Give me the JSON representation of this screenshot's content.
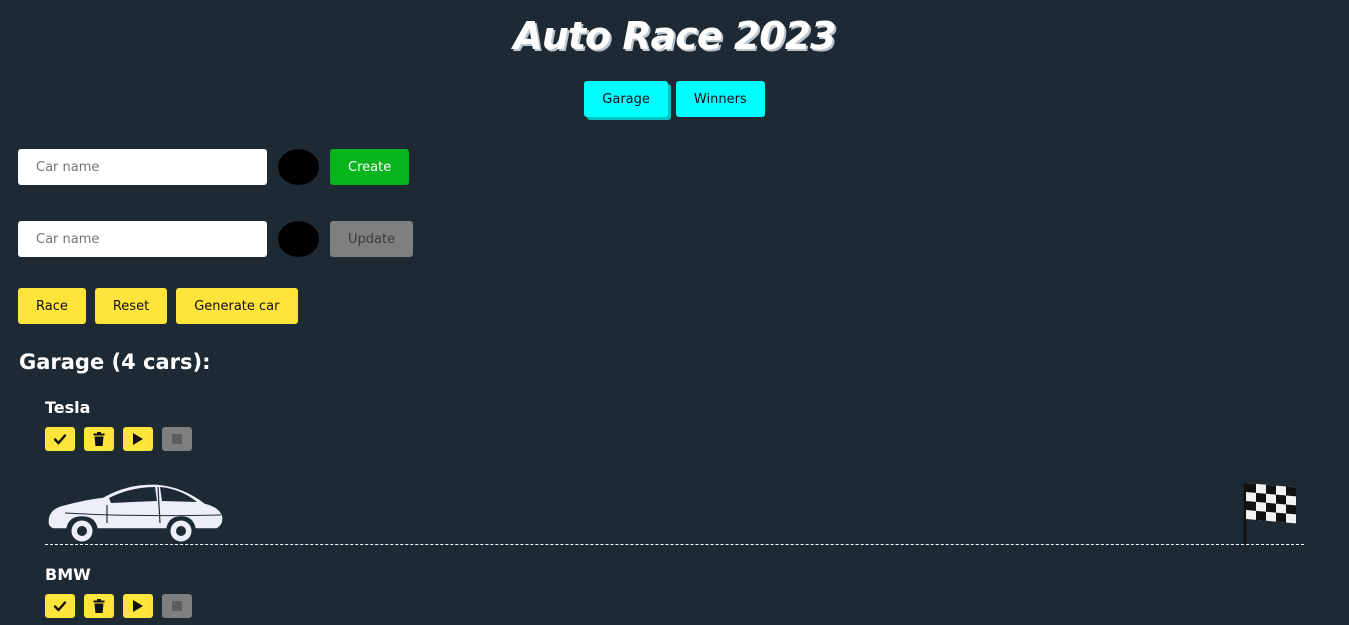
{
  "app": {
    "title": "Auto Race 2023"
  },
  "nav": {
    "garage_label": "Garage",
    "winners_label": "Winners"
  },
  "create_form": {
    "placeholder": "Car name",
    "color": "#000000",
    "button_label": "Create"
  },
  "update_form": {
    "placeholder": "Car name",
    "color": "#000000",
    "button_label": "Update"
  },
  "controls": {
    "race_label": "Race",
    "reset_label": "Reset",
    "generate_label": "Generate car"
  },
  "garage": {
    "heading": "Garage (4 cars):",
    "cars": [
      {
        "name": "Tesla",
        "color": "#eceef9"
      },
      {
        "name": "BMW",
        "color": "#eceef9"
      }
    ]
  },
  "icons": {
    "select": "check-icon",
    "remove": "trash-icon",
    "start": "play-icon",
    "stop": "stop-icon",
    "finish": "checkered-flag-icon"
  },
  "colors": {
    "background": "#1e2a33",
    "nav_accent": "#00ffff",
    "create_button": "#08b41c",
    "update_button_disabled": "#7f7f7f",
    "control_buttons": "#ffe53b"
  }
}
